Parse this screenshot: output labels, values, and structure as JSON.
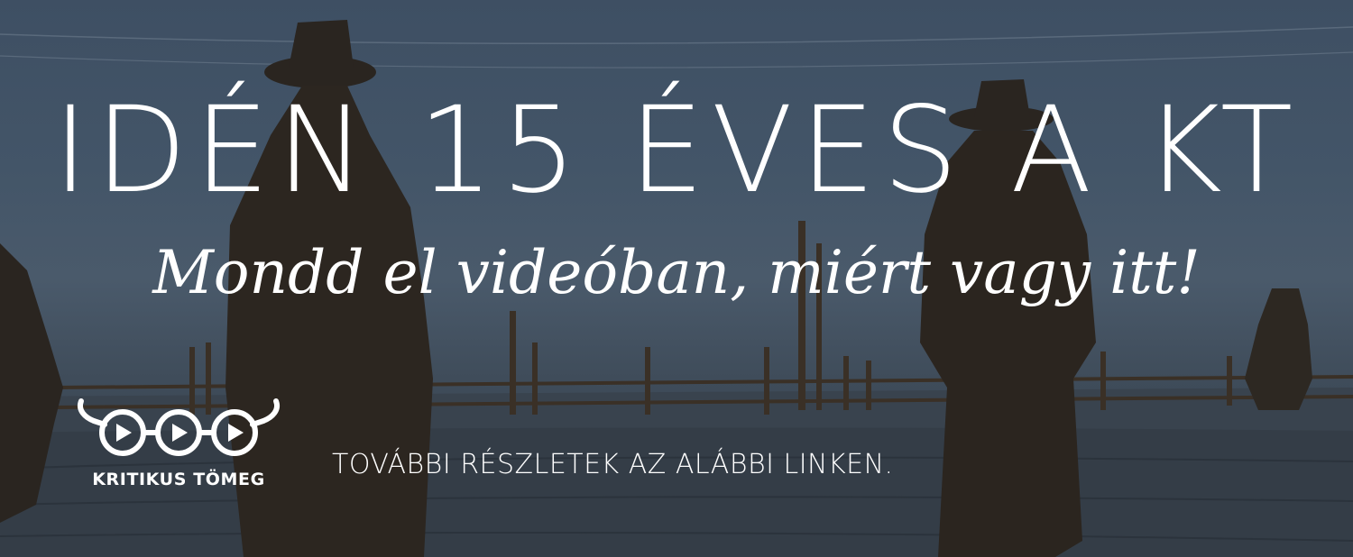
{
  "banner": {
    "headline": "IDÉN 15 ÉVES A KT",
    "subline": "Mondd el videóban, miért vagy itt!",
    "details": "TOVÁBBI RÉSZLETEK AZ ALÁBBI LINKEN."
  },
  "logo": {
    "name": "KRITIKUS TÖMEG",
    "icon": "glasses-play-icon"
  },
  "colors": {
    "text": "#ffffff",
    "sky": "#435568",
    "ground": "#333d48",
    "silhouette": "#2a2520"
  }
}
